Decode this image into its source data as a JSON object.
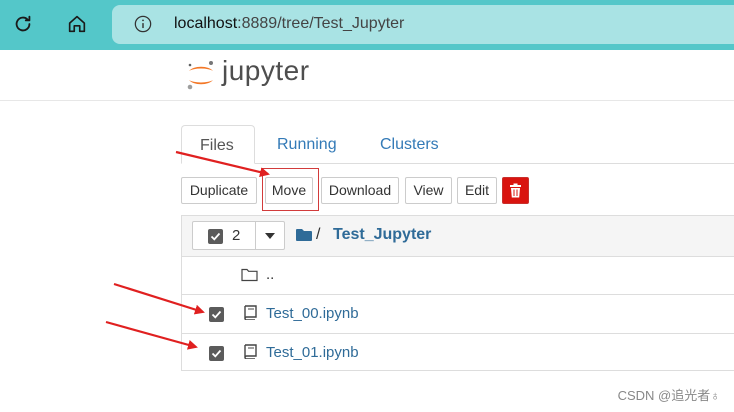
{
  "browser": {
    "url_host": "localhost",
    "url_rest": ":8889/tree/Test_Jupyter"
  },
  "header": {
    "wordmark": "jupyter"
  },
  "tabs": [
    {
      "label": "Files",
      "active": true
    },
    {
      "label": "Running",
      "active": false
    },
    {
      "label": "Clusters",
      "active": false
    }
  ],
  "actions": {
    "duplicate": "Duplicate",
    "move": "Move",
    "download": "Download",
    "view": "View",
    "edit": "Edit"
  },
  "list": {
    "selected_count": "2",
    "breadcrumb_sep": "/",
    "breadcrumb_folder": "Test_Jupyter",
    "parent_dir": "..",
    "items": [
      {
        "name": "Test_00.ipynb",
        "checked": true
      },
      {
        "name": "Test_01.ipynb",
        "checked": true
      }
    ]
  },
  "colors": {
    "browser_bar": "#54c7c9",
    "address_bg": "#a9e3e4",
    "link": "#337ab7",
    "delete_btn": "#d9140f",
    "annotation": "#e02020"
  },
  "watermark": "CSDN @追光者♁"
}
